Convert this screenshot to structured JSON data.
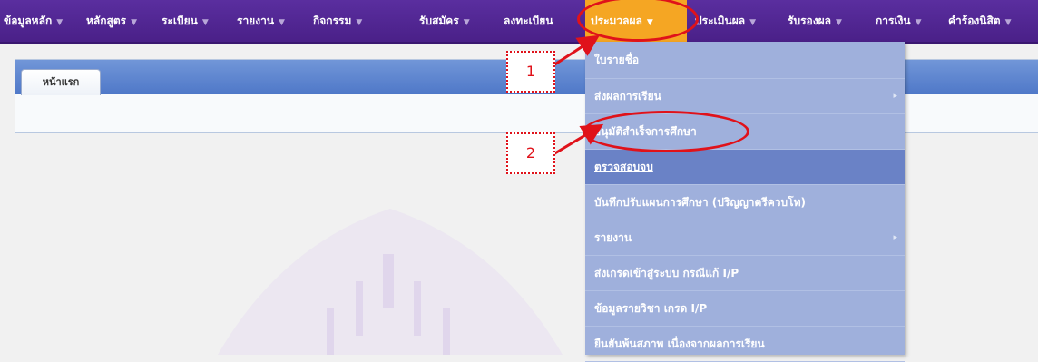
{
  "menubar": {
    "items": [
      {
        "label": "ข้อมูลหลัก"
      },
      {
        "label": "หลักสูตร"
      },
      {
        "label": "ระเบียน"
      },
      {
        "label": "รายงาน"
      },
      {
        "label": "กิจกรรม"
      },
      {
        "label": "รับสมัคร"
      },
      {
        "label": "ลงทะเบียน"
      },
      {
        "label": "ประมวลผล"
      },
      {
        "label": "ประเมินผล"
      },
      {
        "label": "รับรองผล"
      },
      {
        "label": "การเงิน"
      },
      {
        "label": "คำร้องนิสิต"
      }
    ],
    "arrow": "▼",
    "active_color": "#f5a623",
    "bar_color": "#4a2088"
  },
  "tabs": [
    {
      "label": "หน้าแรก"
    }
  ],
  "dropdown": {
    "items": [
      {
        "label": "ใบรายชื่อ"
      },
      {
        "label": "ส่งผลการเรียน",
        "submenu_arrow": "▸"
      },
      {
        "label": "อนุมัติสำเร็จการศึกษา"
      },
      {
        "label": "ตรวจสอบจบ"
      },
      {
        "label": "บันทึกปรับแผนการศึกษา (ปริญญาตรีควบโท)"
      },
      {
        "label": "รายงาน",
        "submenu_arrow": "▸"
      },
      {
        "label": "ส่งเกรดเข้าสู่ระบบ กรณีแก้ I/P"
      },
      {
        "label": "ข้อมูลรายวิชา เกรด I/P"
      },
      {
        "label": "ยืนยันพ้นสภาพ เนื่องจากผลการเรียน"
      }
    ],
    "bg_color": "#9fb0dc",
    "highlight_color": "#6a82c6"
  },
  "annotations": [
    {
      "number": "1"
    },
    {
      "number": "2"
    }
  ],
  "annotation_color": "#e0121a"
}
